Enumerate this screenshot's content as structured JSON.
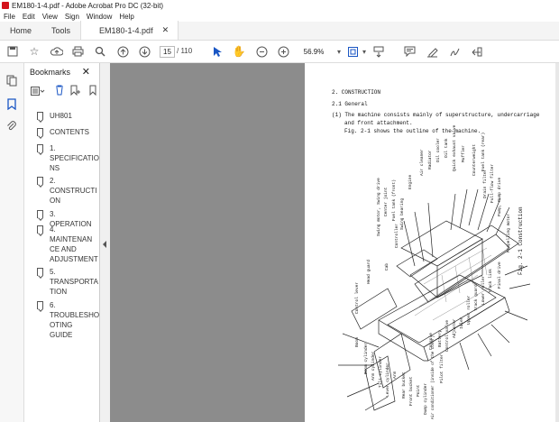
{
  "window": {
    "title": "EM180-1-4.pdf - Adobe Acrobat Pro DC (32-bit)"
  },
  "menu": [
    "File",
    "Edit",
    "View",
    "Sign",
    "Window",
    "Help"
  ],
  "tabs": {
    "home": "Home",
    "tools": "Tools",
    "document": "EM180-1-4.pdf"
  },
  "toolbar": {
    "page_current": "15",
    "page_total": "/ 110",
    "zoom": "56.9%"
  },
  "bookmarks": {
    "title": "Bookmarks",
    "items": [
      "UH801",
      "CONTENTS",
      "1. SPECIFICATIONS",
      "2. CONSTRUCTION",
      "3. OPERATION",
      "4. MAINTENANCE AND ADJUSTMENT",
      "5. TRANSPORTATION",
      "6. TROUBLESHOOTING GUIDE"
    ],
    "item_lines": [
      [
        "UH801"
      ],
      [
        "CONTENTS"
      ],
      [
        "1.",
        "SPECIFICATIO",
        "NS"
      ],
      [
        "2.",
        "CONSTRUCTI",
        "ON"
      ],
      [
        "3. OPERATION"
      ],
      [
        "4.",
        "MAINTENAN",
        "CE AND",
        "ADJUSTMENT"
      ],
      [
        "5.",
        "TRANSPORTA",
        "TION"
      ],
      [
        "6.",
        "TROUBLESHO",
        "OTING GUIDE"
      ]
    ]
  },
  "pdf_page": {
    "heading": "2.  CONSTRUCTION",
    "section": "2.1 General",
    "para_line1": "(1)  The machine consists mainly of superstructure, undercarriage",
    "para_line2": "and front attachment.",
    "para_line3": "Fig. 2-1 shows the outline of the machine.",
    "figure_caption": "Fig. 2-1 Construction",
    "labels_upper": [
      "Swing motor, Swing drive",
      "Center joint",
      "Fuel tank (front)",
      "Engine",
      "Air cleaner",
      "Radiator",
      "Oil cooler",
      "Oil tank",
      "Quick exhaust valve",
      "Muffler",
      "Counterweight",
      "Fuel tank (rear)",
      "Swing bearing",
      "Controller",
      "Cab",
      "Head guard"
    ],
    "labels_right": [
      "Drain filter",
      "Full-flow filter",
      "Pump, Pump drive",
      "Propelling motor",
      "Final drive",
      "Track link",
      "Lower roller",
      "Track guard",
      "Upper roller",
      "Idler",
      "Adjuster",
      "Control valve",
      "Battery"
    ],
    "labels_lower": [
      "Control lever",
      "Boom",
      "Boom cylinder",
      "Arm cylinder",
      "Tilt cylinder",
      "Lever cylinder",
      "Arm",
      "Rear bucket",
      "Front bucket",
      "Point",
      "Dump cylinder",
      "Console",
      "Air conditioner (inside of the cover)",
      "Pilot filter"
    ]
  }
}
